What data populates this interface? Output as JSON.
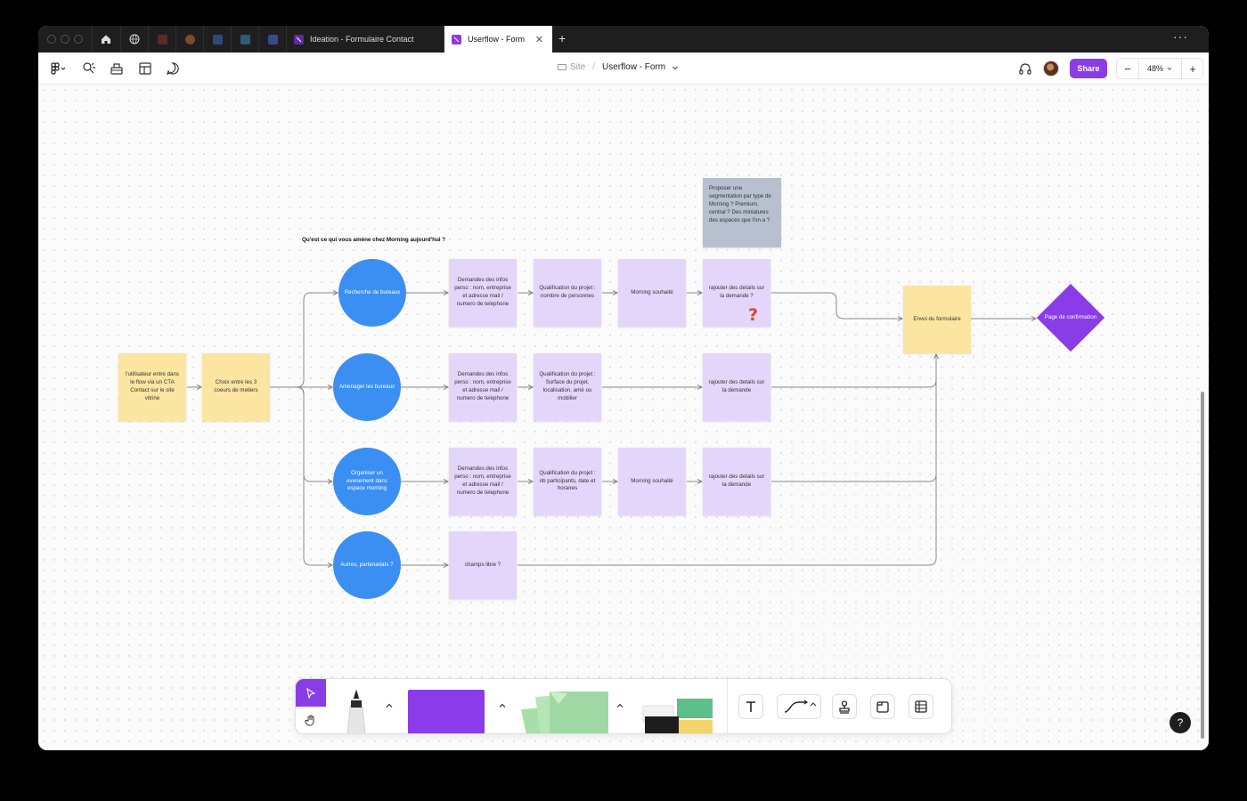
{
  "browser": {
    "tabs": [
      {
        "title": "Ideation - Formulaire Contact"
      },
      {
        "title": "Userflow - Form"
      }
    ]
  },
  "header": {
    "breadcrumb_project": "Site",
    "file_title": "Userflow - Form",
    "share_label": "Share",
    "zoom": "48%"
  },
  "board": {
    "question": "Qu'est ce qui vous amène chez Morning aujourd'hui ?",
    "nodes": {
      "start": "l'utilisateur entre dans le flow via un CTA Contact sur le site vitrine",
      "choice": "Choix entre les 3 coeurs de metiers",
      "c1": "Recherche de bureaux",
      "c2": "Amenager les bureaux",
      "c3": "Organiser un evenement dans espace morning",
      "c4": "Autres, partenariats ?",
      "r1a": "Demandes des infos perso : nom, entreprise et adresse mail / numero de telephone",
      "r1b": "Qualification du projet : nombre de personnes",
      "r1c": "Morning souhaité",
      "r1d": "rajouter des details sur la demande ?",
      "r2a": "Demandes des infos perso : nom, entreprise et adresse mail / numero de telephone",
      "r2b": "Qualification du projet : Surface du projet, localisation, amé ou mobilier",
      "r2d": "rajouter des details sur la demande",
      "r3a": "Demandes des infos perso : nom, entreprise et adresse mail / numero de telephone",
      "r3b": "Qualification du projet : nb participants, date et horaires",
      "r3c": "Morning souhaité",
      "r3d": "rajouter des details sur la demande",
      "r4a": "champs libre ?",
      "envoi": "Envoi du formulaire",
      "confirm": "Page de confirmation",
      "note": "Proposer une segmentation par type de Morning ? Premium, central ? Des miniatures des espaces que l'on a ?",
      "question_mark": "?"
    }
  },
  "colors": {
    "sticky_purple": "#e3d6fa",
    "sticky_yellow": "#fbe5a0",
    "circle_blue": "#3b8ff2",
    "diamond_purple": "#8a3ce8",
    "accent": "#8a3ce8"
  }
}
